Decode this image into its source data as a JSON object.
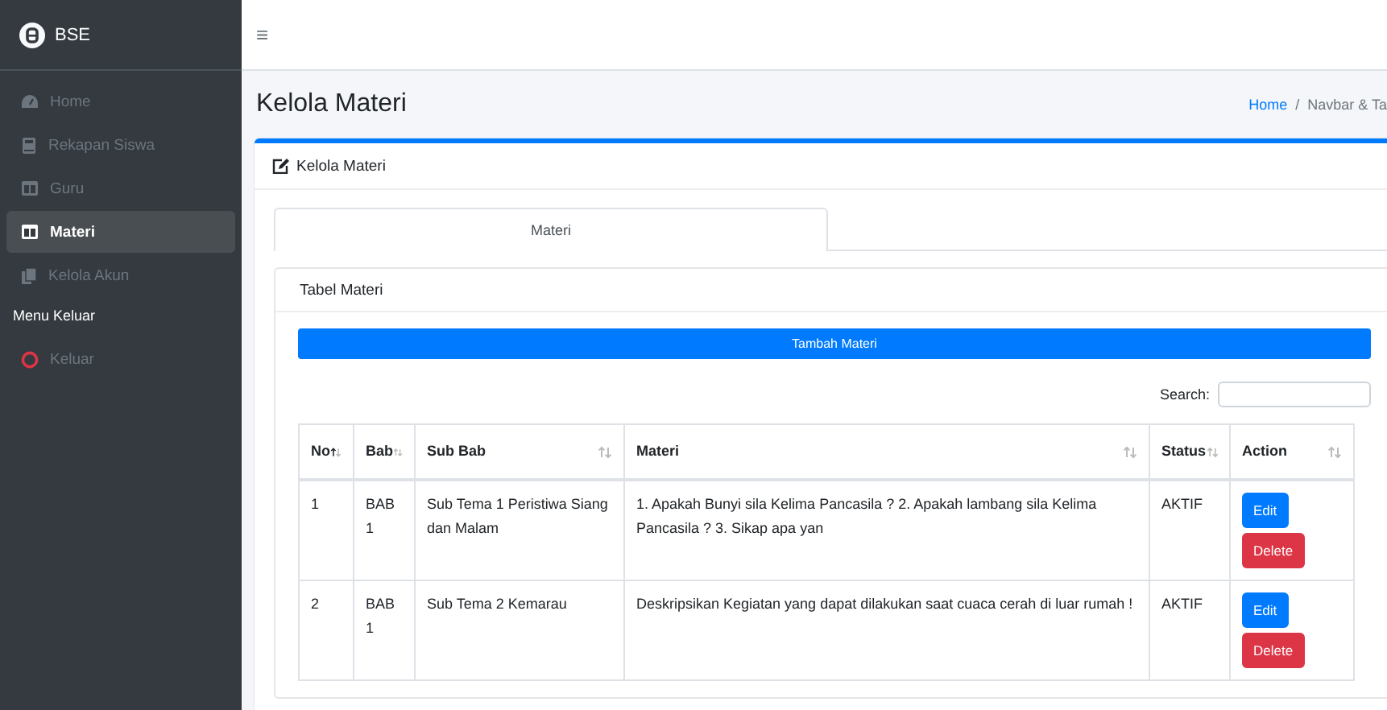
{
  "brand": {
    "name": "BSE"
  },
  "sidebar": {
    "items": [
      {
        "label": "Home",
        "selected": false
      },
      {
        "label": "Rekapan Siswa",
        "selected": false
      },
      {
        "label": "Guru",
        "selected": false
      },
      {
        "label": "Materi",
        "selected": true
      },
      {
        "label": "Kelola Akun",
        "selected": false
      }
    ],
    "section": "Menu Keluar",
    "logout": {
      "label": "Keluar"
    }
  },
  "topbar": {
    "menu": "≡"
  },
  "page": {
    "title": "Kelola Materi",
    "breadcrumb": {
      "items": [
        "Home",
        "Navbar & Ta"
      ],
      "separator": "/"
    }
  },
  "card": {
    "title": "Kelola Materi",
    "tabs": [
      {
        "label": "Materi",
        "selected": true
      }
    ]
  },
  "table_card": {
    "title": "Tabel Materi",
    "add_button": "Tambah Materi",
    "search_label": "Search:"
  },
  "table": {
    "columns": [
      {
        "label": "No",
        "sorted": true
      },
      {
        "label": "Bab",
        "sorted": false
      },
      {
        "label": "Sub Bab",
        "sorted": false
      },
      {
        "label": "Materi",
        "sorted": false
      },
      {
        "label": "Status",
        "sorted": false
      },
      {
        "label": "Action",
        "sorted": false
      }
    ],
    "rows": [
      {
        "no": "1",
        "bab": "BAB 1",
        "sub_bab": "Sub Tema 1 Peristiwa Siang dan Malam",
        "materi": "1. Apakah Bunyi sila Kelima Pancasila ? 2. Apakah lambang sila Kelima Pancasila ? 3. Sikap apa yan",
        "status": "AKTIF",
        "actions": [
          "Edit",
          "Delete"
        ]
      },
      {
        "no": "2",
        "bab": "BAB 1",
        "sub_bab": "Sub Tema 2 Kemarau",
        "materi": "Deskripsikan Kegiatan yang dapat dilakukan saat cuaca cerah di luar rumah !",
        "status": "AKTIF",
        "actions": [
          "Edit",
          "Delete"
        ]
      }
    ]
  }
}
